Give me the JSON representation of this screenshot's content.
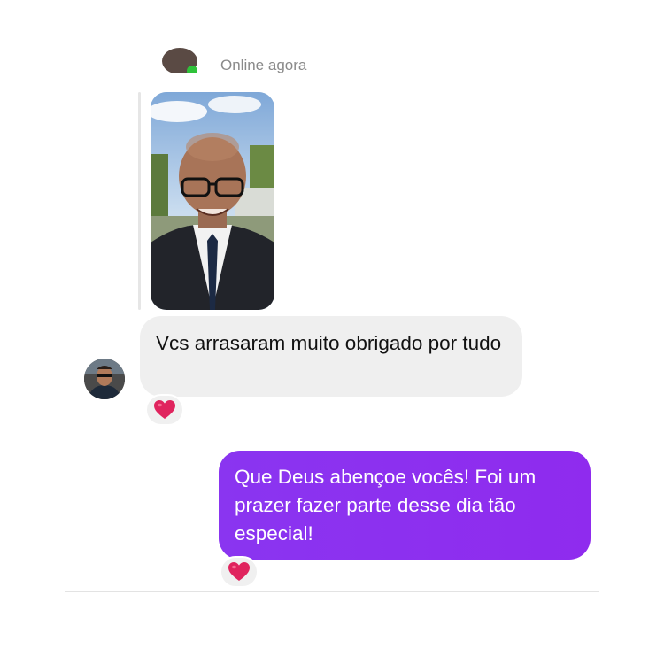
{
  "header": {
    "status_text": "Online agora"
  },
  "conversation": {
    "incoming_message": "Vcs arrasaram muito obrigado por tudo",
    "outgoing_message": "Que Deus abençoe vocês! Foi um prazer fazer parte desse dia tão especial!",
    "reaction_emoji": "❤️",
    "icons": {
      "reaction": "heart-icon",
      "online": "online-dot-icon"
    },
    "colors": {
      "outgoing_bubble": "#8a35f0",
      "incoming_bubble": "#efefef",
      "heart": "#e0245e",
      "online_dot": "#2fc23a"
    }
  }
}
